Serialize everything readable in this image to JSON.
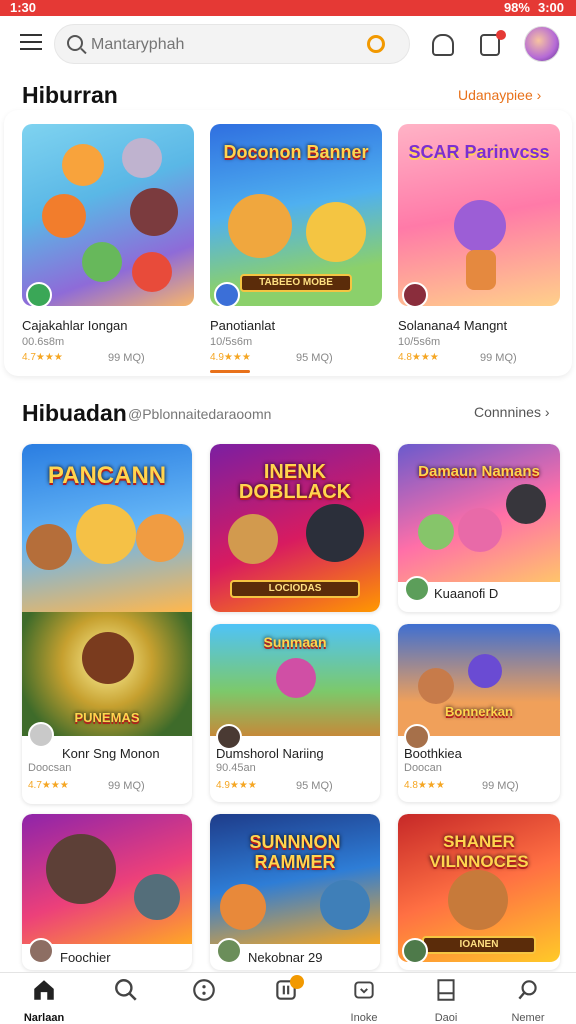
{
  "status": {
    "left": "1:30",
    "battery": "98%",
    "time": "3:00"
  },
  "search": {
    "placeholder": "Mantaryphah"
  },
  "section1": {
    "title": "Hiburran",
    "link": "Udanaypiee"
  },
  "row1": [
    {
      "title": "Cajakahlar Iongan",
      "sub": "00.6s8m",
      "rating": "4.7★★★",
      "size": "99 MQ)"
    },
    {
      "title": "Panotianlat",
      "sub": "10/5s6m",
      "rating": "4.9★★★",
      "size": "95 MQ)",
      "art": "Doconon Banner",
      "banner": "ТАВЕЕО МОВЕ"
    },
    {
      "title": "Solanana4 Mangnt",
      "sub": "10/5s6m",
      "rating": "4.8★★★",
      "size": "99 MQ)",
      "art": "SCAR Parinvcss"
    }
  ],
  "section2": {
    "title": "Hibuadan",
    "sub": "@Pblonnaitedaraoomn",
    "link": "Connnines"
  },
  "grid": [
    {
      "art": "PANCANN"
    },
    {
      "art": "INENK DOBLLACK",
      "banner": "LOCIODAS"
    },
    {
      "art": "Damaun Namans",
      "title": "Kuaanofi D"
    },
    {
      "art": "PUNEMAS",
      "title": "Konr Sng Monon",
      "sub": "Doocsan",
      "rating": "4.7★★★",
      "size": "99 MQ)"
    },
    {
      "art": "Sunmaan",
      "title": "Dumshorol Nariing",
      "sub": "90.45an",
      "rating": "4.9★★★",
      "size": "95 MQ)"
    },
    {
      "art": "Bonnerkan",
      "title": "Boothkiea",
      "sub": "Doocan",
      "rating": "4.8★★★",
      "size": "99 MQ)"
    },
    {
      "art": "",
      "title": "Foochier"
    },
    {
      "art": "SUNNNON RAMMER",
      "title": "Nekobnar 29"
    },
    {
      "art": "SHANER VILNNOCES",
      "banner": "IOANEN"
    }
  ],
  "bottomnav": [
    {
      "label": "Narlaan"
    },
    {
      "label": ""
    },
    {
      "label": ""
    },
    {
      "label": ""
    },
    {
      "label": "Inoke"
    },
    {
      "label": "Daoi"
    },
    {
      "label": "Nemer"
    }
  ],
  "colors": {
    "accent": "#e8711a",
    "statusbar": "#e53935"
  }
}
